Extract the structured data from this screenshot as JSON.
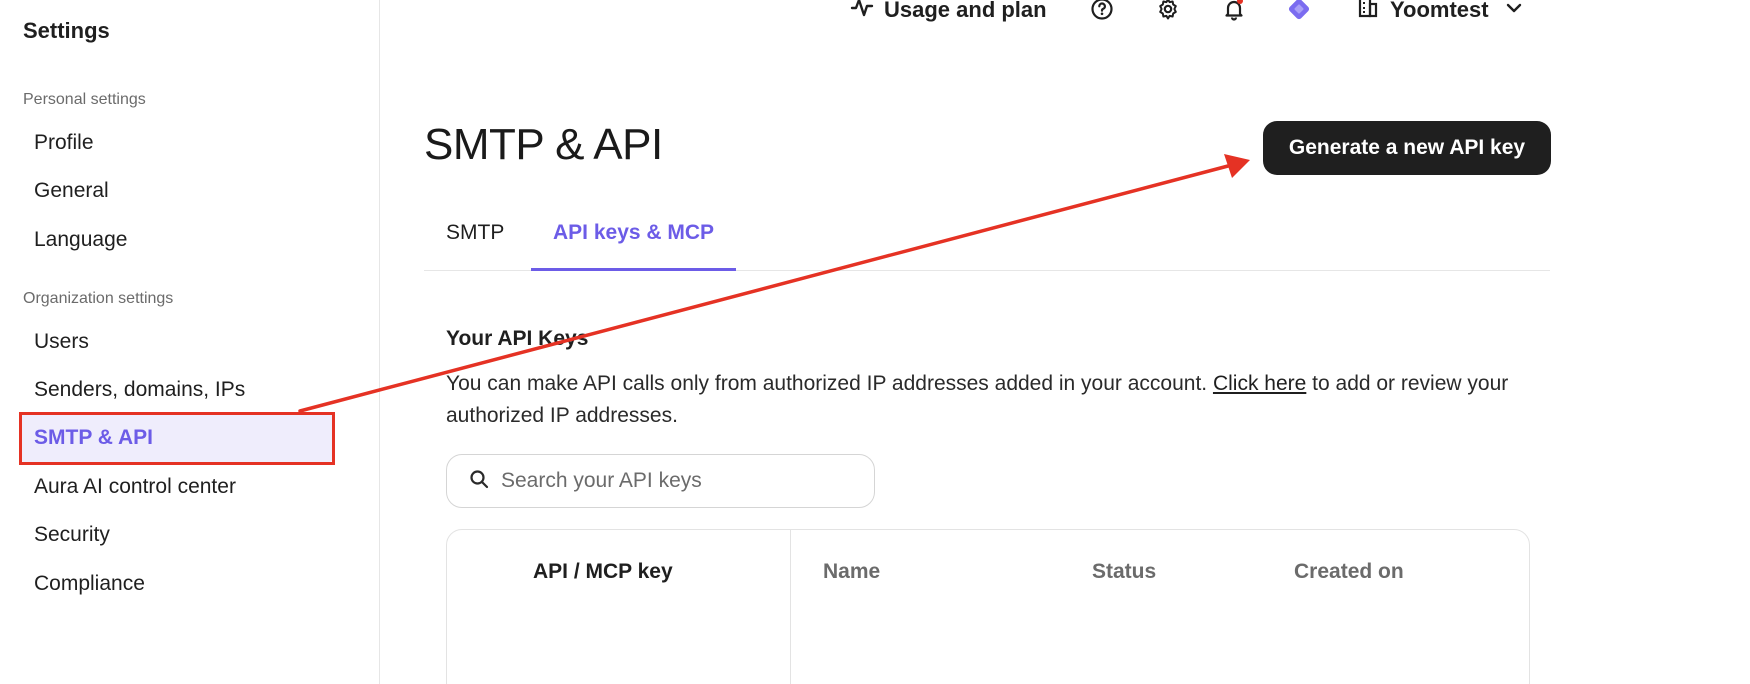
{
  "sidebar": {
    "title": "Settings",
    "personal_label": "Personal settings",
    "personal_items": [
      {
        "label": "Profile"
      },
      {
        "label": "General"
      },
      {
        "label": "Language"
      }
    ],
    "org_label": "Organization settings",
    "org_items": [
      {
        "label": "Users"
      },
      {
        "label": "Senders, domains, IPs"
      },
      {
        "label": "SMTP & API",
        "active": true
      },
      {
        "label": "Aura AI control center"
      },
      {
        "label": "Security"
      },
      {
        "label": "Compliance"
      }
    ]
  },
  "topbar": {
    "usage_label": "Usage and plan",
    "account_name": "Yoomtest",
    "icons": [
      "activity-icon",
      "help-icon",
      "gear-icon",
      "bell-icon",
      "diamond-icon",
      "building-icon",
      "chevron-down-icon"
    ]
  },
  "main": {
    "title": "SMTP & API",
    "generate_button": "Generate a new API key",
    "tabs": [
      {
        "label": "SMTP"
      },
      {
        "label": "API keys & MCP",
        "active": true
      }
    ],
    "keys_heading": "Your API Keys",
    "keys_desc_before": "You can make API calls only from authorized IP addresses added in your account. ",
    "keys_desc_link": "Click here",
    "keys_desc_after": " to add or review your authorized IP addresses.",
    "search_placeholder": "Search your API keys",
    "table_headers": [
      "API / MCP key",
      "Name",
      "Status",
      "Created on"
    ]
  },
  "colors": {
    "accent": "#6c5ce7",
    "annotation_red": "#e53224",
    "button_dark": "#1f1f1f"
  }
}
